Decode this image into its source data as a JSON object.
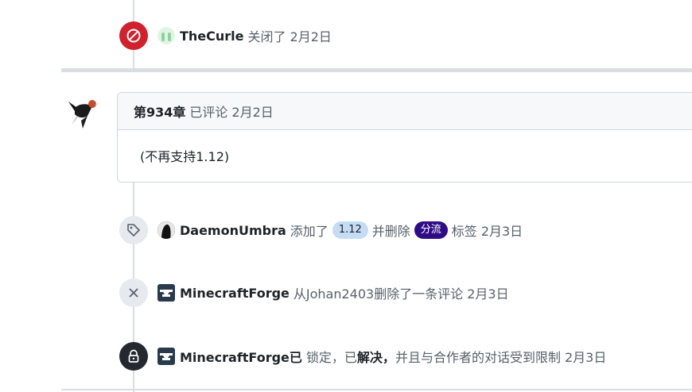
{
  "events": [
    {
      "id": "closed",
      "actor": "TheCurle",
      "text": "关闭了",
      "time": "2月2日"
    },
    {
      "id": "labeled",
      "actor": "DaemonUmbra",
      "text_added": "添加了",
      "label_added": "1.12",
      "text_removed": "并删除",
      "label_removed": "分流",
      "text_suffix": "标签",
      "time": "2月3日"
    },
    {
      "id": "deleted-comment",
      "actor": "MinecraftForge",
      "text": "从Johan2403删除了一条评论",
      "time": "2月3日"
    },
    {
      "id": "locked",
      "actor": "MinecraftForge已",
      "text_pre": "锁定，已",
      "text_bold": "解决，",
      "text_post": "并且与合作者的对话受到限制",
      "time": "2月3日"
    }
  ],
  "comment": {
    "author": "第934章",
    "action": "已评论",
    "time": "2月2日",
    "body": "(不再支持1.12)"
  },
  "colors": {
    "closed": "#cf222e",
    "label_blue": "#c5dcf5",
    "label_purple": "#2f0c85",
    "locked": "#24292f"
  },
  "icons": [
    "circle-slash-icon",
    "tag-icon",
    "x-icon",
    "lock-icon"
  ]
}
